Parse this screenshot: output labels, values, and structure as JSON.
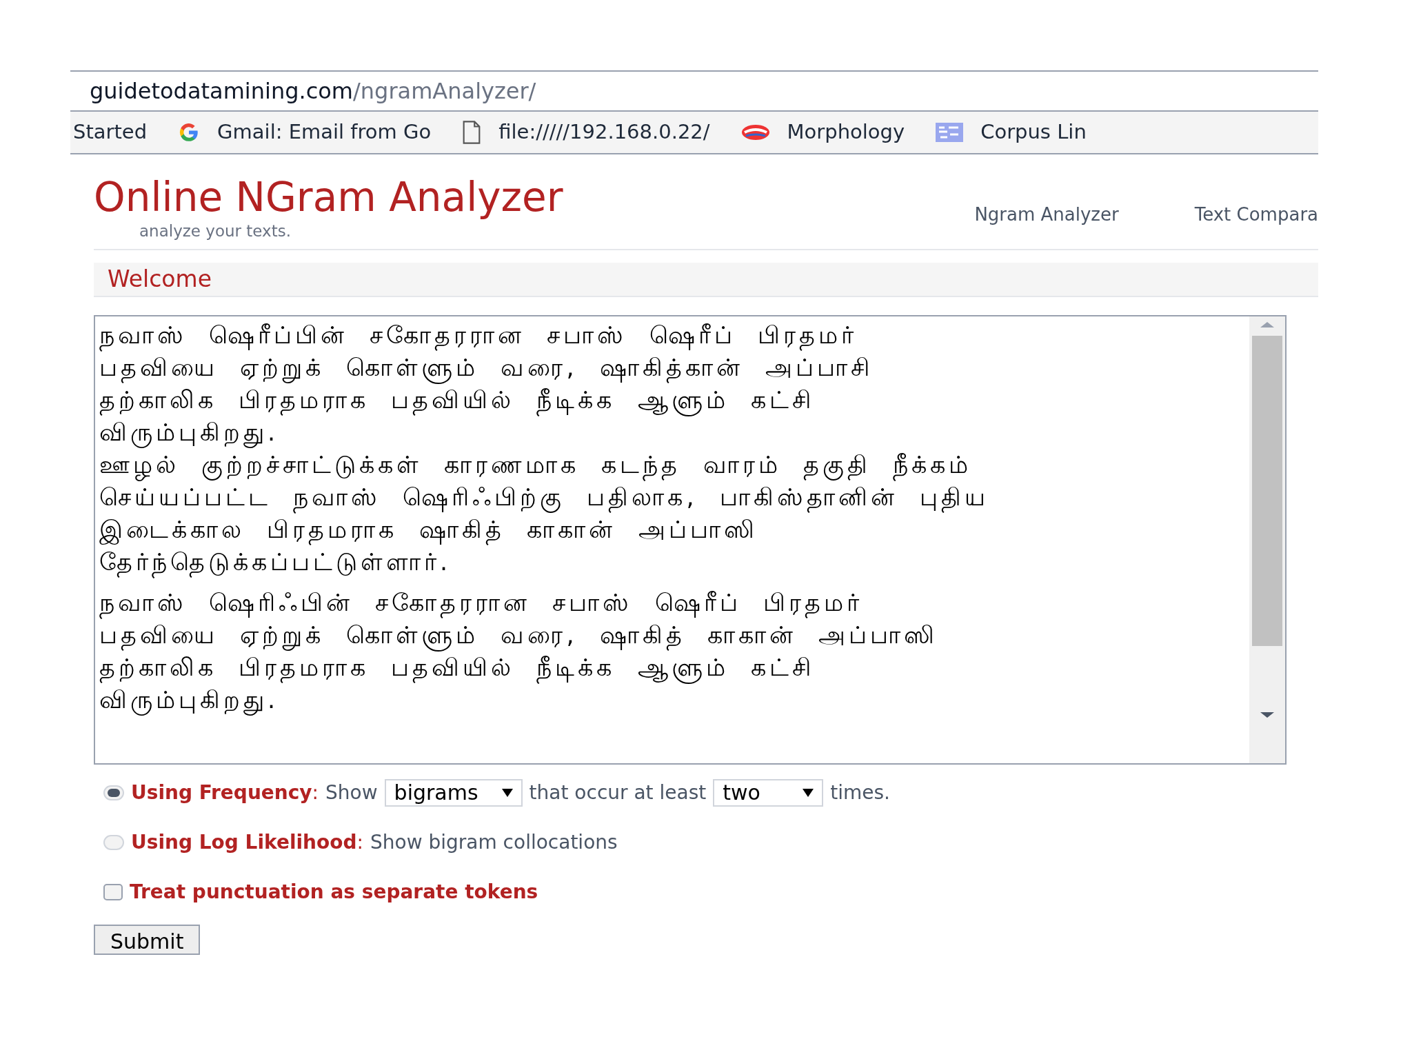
{
  "address_bar": {
    "host": "guidetodatamining.com",
    "path": "/ngramAnalyzer/"
  },
  "bookmarks": [
    {
      "kind": "text",
      "label": "Started"
    },
    {
      "kind": "google",
      "label": "Gmail: Email from Go"
    },
    {
      "kind": "file",
      "label": "file://///192.168.0.22/"
    },
    {
      "kind": "logo",
      "label": "Morphology"
    },
    {
      "kind": "image",
      "label": "Corpus Lin"
    }
  ],
  "site": {
    "title": "Online NGram Analyzer",
    "tagline": "analyze your texts.",
    "nav": [
      "Ngram Analyzer",
      "Text Compara"
    ]
  },
  "section_title": "Welcome",
  "text_input": {
    "paragraphs": [
      [
        "நவாஸ் ஷெரீப்பின் சகோதரரான சபாஸ் ஷெரீப் பிரதமர்",
        "பதவியை ஏற்றுக் கொள்ளும் வரை, ஷாகித்கான் அப்பாசி",
        "தற்காலிக பிரதமராக பதவியில் நீடிக்க ஆளும் கட்சி",
        "விரும்புகிறது.",
        "ஊழல் குற்றச்சாட்டுக்கள் காரணமாக கடந்த வாரம் தகுதி நீக்கம்",
        "செய்யப்பட்ட நவாஸ் ஷெரிஃபிற்கு பதிலாக, பாகிஸ்தானின் புதிய",
        "இடைக்கால பிரதமராக ஷாகித் காகான் அப்பாஸி",
        "தேர்ந்தெடுக்கப்பட்டுள்ளார்."
      ],
      [
        "நவாஸ் ஷெரிஃபின் சகோதரரான சபாஸ் ஷெரீப் பிரதமர்",
        "பதவியை ஏற்றுக் கொள்ளும் வரை, ஷாகித் காகான் அப்பாஸி",
        "தற்காலிக பிரதமராக பதவியில் நீடிக்க ஆளும் கட்சி",
        "விரும்புகிறது."
      ]
    ]
  },
  "options": [
    {
      "kind": "frequency",
      "selected": true,
      "label": "**Using Frequency**:",
      "show": "Show",
      "ngram": "bigrams",
      "middle": "that occur at least",
      "count": "two",
      "end": "times."
    },
    {
      "kind": "loglikelihood",
      "selected": false,
      "label": "**Using Log Likelihood**:",
      "text": "Show bigram collocations"
    }
  ],
  "punctuation": {
    "checked": false,
    "label": "Treat punctuation as separate tokens"
  },
  "submit": "Submit"
}
